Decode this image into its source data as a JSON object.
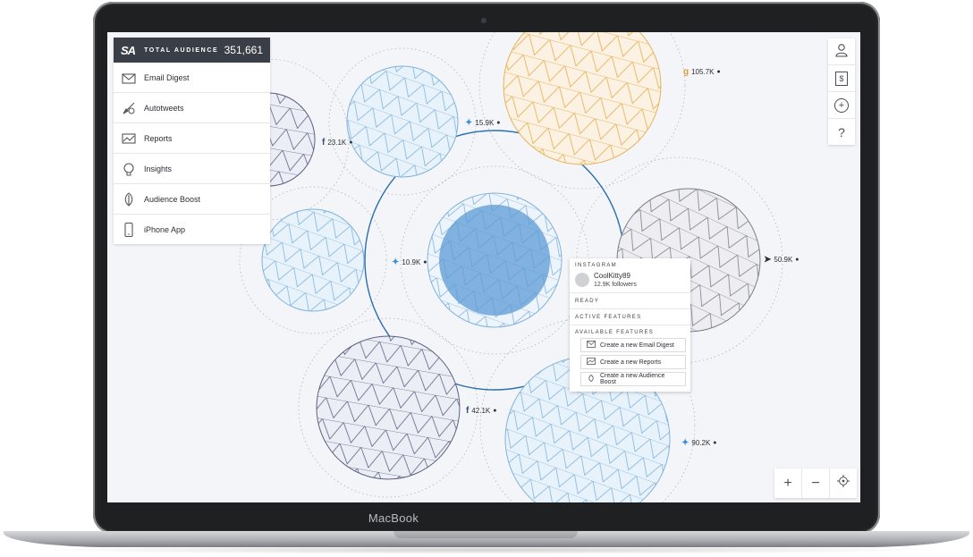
{
  "device": {
    "brand_label": "MacBook"
  },
  "header": {
    "logo": "SA",
    "label": "TOTAL AUDIENCE",
    "value": "351,661"
  },
  "sidebar": {
    "items": [
      {
        "label": "Email Digest",
        "icon": "envelope-icon"
      },
      {
        "label": "Autotweets",
        "icon": "autotweet-icon"
      },
      {
        "label": "Reports",
        "icon": "reports-icon"
      },
      {
        "label": "Insights",
        "icon": "lightbulb-icon"
      },
      {
        "label": "Audience Boost",
        "icon": "leaf-icon"
      },
      {
        "label": "iPhone App",
        "icon": "phone-icon"
      }
    ]
  },
  "toolbar": {
    "items": [
      {
        "icon": "user-icon",
        "label": ""
      },
      {
        "icon": "dollar-icon",
        "label": "$"
      },
      {
        "icon": "plus-circle-icon",
        "label": "+"
      },
      {
        "icon": "help-icon",
        "label": "?"
      }
    ]
  },
  "zoom": {
    "in": "+",
    "out": "−"
  },
  "nodes": [
    {
      "network": "google-plus",
      "glyph": "g",
      "value": "105.7K",
      "color": "#e39a35"
    },
    {
      "network": "twitter",
      "glyph": "▲",
      "value": "15.9K",
      "color": "#3b8fd6"
    },
    {
      "network": "facebook",
      "glyph": "f",
      "value": "23.1K",
      "color": "#3b4a7a"
    },
    {
      "network": "twitter",
      "glyph": "▲",
      "value": "10.9K",
      "color": "#3b8fd6"
    },
    {
      "network": "telegram",
      "glyph": "➤",
      "value": "50.9K",
      "color": "#2c2f35"
    },
    {
      "network": "facebook",
      "glyph": "f",
      "value": "42.1K",
      "color": "#3b4a7a"
    },
    {
      "network": "twitter",
      "glyph": "▲",
      "value": "90.2K",
      "color": "#3b8fd6"
    }
  ],
  "card": {
    "network_label": "INSTAGRAM",
    "account_name": "CoolKitty89",
    "followers": "12.9K followers",
    "status": "READY",
    "active_label": "ACTIVE FEATURES",
    "available_label": "AVAILABLE FEATURES",
    "actions": [
      {
        "label": "Create a new Email Digest",
        "icon": "envelope-icon"
      },
      {
        "label": "Create a new Reports",
        "icon": "reports-icon"
      },
      {
        "label": "Create a new Audience Boost",
        "icon": "leaf-icon"
      }
    ]
  },
  "colors": {
    "accent": "#2a6db0",
    "sphere_blue": "#7fb3dd",
    "sphere_orange": "#e8b25a",
    "sphere_gray": "#7a7d88",
    "panel_dark": "#3a3f47"
  }
}
